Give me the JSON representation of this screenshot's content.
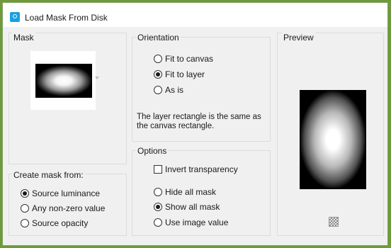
{
  "window": {
    "title": "Load Mask From Disk"
  },
  "mask": {
    "group_label": "Mask"
  },
  "create_mask": {
    "group_label": "Create mask from:",
    "options": [
      {
        "label": "Source luminance",
        "checked": true
      },
      {
        "label": "Any non-zero value",
        "checked": false
      },
      {
        "label": "Source opacity",
        "checked": false
      }
    ]
  },
  "orientation": {
    "group_label": "Orientation",
    "options": [
      {
        "label": "Fit to canvas",
        "checked": false
      },
      {
        "label": "Fit to layer",
        "checked": true
      },
      {
        "label": "As is",
        "checked": false
      }
    ],
    "note_line1": "The layer rectangle is the same as",
    "note_line2": "the canvas rectangle."
  },
  "options": {
    "group_label": "Options",
    "invert_label": "Invert transparency",
    "invert_checked": false,
    "visibility": [
      {
        "label": "Hide all mask",
        "checked": false
      },
      {
        "label": "Show all mask",
        "checked": true
      },
      {
        "label": "Use image value",
        "checked": false
      }
    ]
  },
  "preview": {
    "group_label": "Preview",
    "transparency_icon": "checkerboard-icon"
  }
}
